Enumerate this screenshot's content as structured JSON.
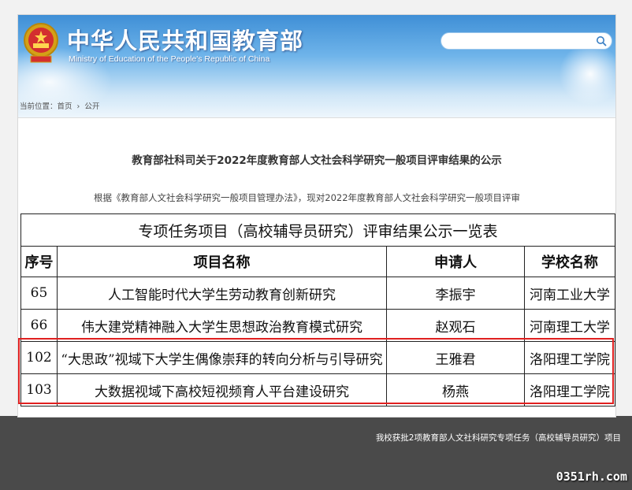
{
  "header": {
    "title_cn": "中华人民共和国教育部",
    "title_en": "Ministry of Education of the People's Republic of China",
    "search_placeholder": ""
  },
  "breadcrumb": {
    "prefix": "当前位置：",
    "home": "首页",
    "separator": "›",
    "current": "公开"
  },
  "document": {
    "title": "教育部社科司关于2022年度教育部人文社会科学研究一般项目评审结果的公示",
    "intro": "根据《教育部人文社会科学研究一般项目管理办法》，现对2022年度教育部人文社会科学研究一般项目评审"
  },
  "table": {
    "caption": "专项任务项目（高校辅导员研究）评审结果公示一览表",
    "headers": [
      "序号",
      "项目名称",
      "申请人",
      "学校名称"
    ],
    "rows": [
      {
        "no": "65",
        "project": "人工智能时代大学生劳动教育创新研究",
        "applicant": "李振宇",
        "school": "河南工业大学"
      },
      {
        "no": "66",
        "project": "伟大建党精神融入大学生思想政治教育模式研究",
        "applicant": "赵观石",
        "school": "河南理工大学"
      },
      {
        "no": "102",
        "project": "“大思政”视域下大学生偶像崇拜的转向分析与引导研究",
        "applicant": "王雅君",
        "school": "洛阳理工学院"
      },
      {
        "no": "103",
        "project": "大数据视域下高校短视频育人平台建设研究",
        "applicant": "杨燕",
        "school": "洛阳理工学院"
      }
    ]
  },
  "bottom_caption": "我校获批2项教育部人文社科研究专项任务（高校辅导员研究）项目",
  "watermark": "0351rh.com",
  "colors": {
    "header_blue": "#3f8fd6",
    "highlight_red": "#e02020",
    "bottom_bar": "#4a4a4a"
  }
}
